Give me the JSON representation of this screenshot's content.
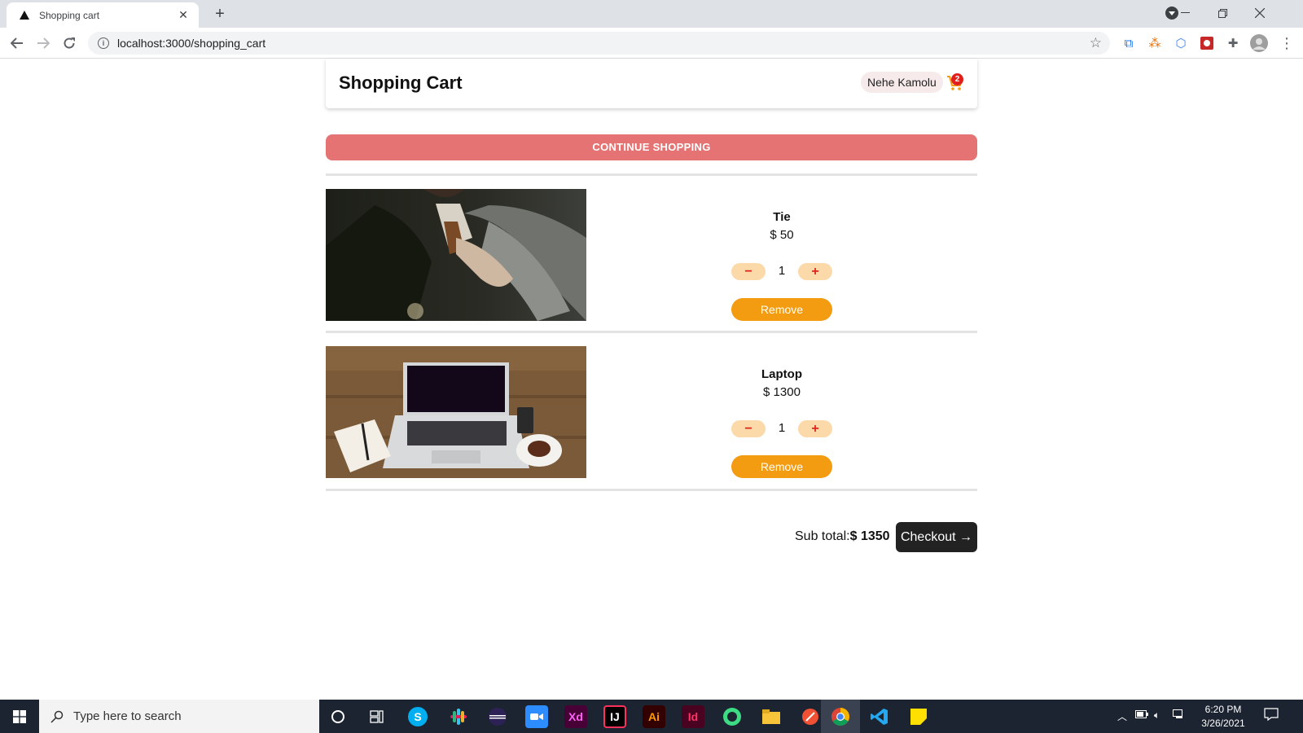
{
  "browser": {
    "tab_title": "Shopping cart",
    "new_tab": "+",
    "url": "localhost:3000/shopping_cart"
  },
  "header": {
    "title": "Shopping Cart",
    "user_name": "Nehe Kamolu",
    "cart_count": "2"
  },
  "continue_label": "CONTINUE SHOPPING",
  "items": [
    {
      "name": "Tie",
      "price": "$ 50",
      "quantity": "1",
      "minus": "−",
      "plus": "+",
      "remove_label": "Remove"
    },
    {
      "name": "Laptop",
      "price": "$ 1300",
      "quantity": "1",
      "minus": "−",
      "plus": "+",
      "remove_label": "Remove"
    }
  ],
  "summary": {
    "subtotal_label": "Sub total:",
    "subtotal_value": "$ 1350",
    "checkout_label": "Checkout",
    "checkout_arrow": "→"
  },
  "taskbar": {
    "search_placeholder": "Type here to search",
    "apps": [
      "cortana",
      "task-view",
      "skype",
      "slack",
      "eclipse",
      "zoom",
      "adobe-xd",
      "intellij",
      "illustrator",
      "indesign",
      "android-studio",
      "file-explorer",
      "git",
      "chrome",
      "vscode",
      "sticky-notes"
    ],
    "time": "6:20 PM",
    "date": "3/26/2021"
  },
  "colors": {
    "accent_red": "#e57373",
    "remove_orange": "#f39c12",
    "qty_button_bg": "#fcd9a8",
    "qty_symbol": "#e2231a",
    "checkout_bg": "#222222",
    "badge_red": "#e0201c"
  }
}
